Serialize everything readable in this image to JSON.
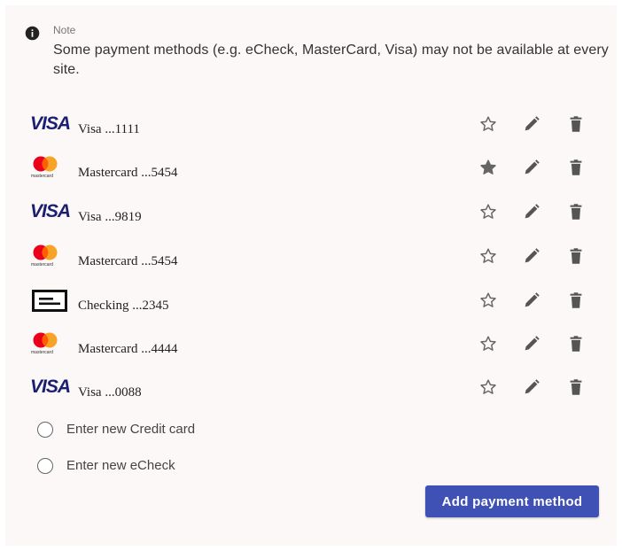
{
  "note": {
    "label": "Note",
    "text": "Some payment methods (e.g. eCheck, MasterCard, Visa) may not be available at every site."
  },
  "methods": [
    {
      "type": "visa",
      "logo_text": "VISA",
      "label": "Visa ...1111",
      "favorite": false
    },
    {
      "type": "mastercard",
      "logo_text": "mastercard",
      "label": "Mastercard ...5454",
      "favorite": true
    },
    {
      "type": "visa",
      "logo_text": "VISA",
      "label": "Visa ...9819",
      "favorite": false
    },
    {
      "type": "mastercard",
      "logo_text": "mastercard",
      "label": "Mastercard ...5454",
      "favorite": false
    },
    {
      "type": "echeck",
      "logo_text": "",
      "label": "Checking ...2345",
      "favorite": false
    },
    {
      "type": "mastercard",
      "logo_text": "mastercard",
      "label": "Mastercard ...4444",
      "favorite": false
    },
    {
      "type": "visa",
      "logo_text": "VISA",
      "label": "Visa ...0088",
      "favorite": false
    }
  ],
  "options": {
    "credit_card": "Enter new Credit card",
    "echeck": "Enter new eCheck"
  },
  "add_button": "Add payment method",
  "icons": {
    "info": "info-icon",
    "star": "star-icon",
    "edit": "pencil-icon",
    "delete": "trash-icon"
  },
  "colors": {
    "accent": "#3f51b5",
    "visa_blue": "#1a1f71",
    "mc_red": "#eb001b",
    "mc_orange": "#f79e1b",
    "icon_gray": "#666666"
  }
}
